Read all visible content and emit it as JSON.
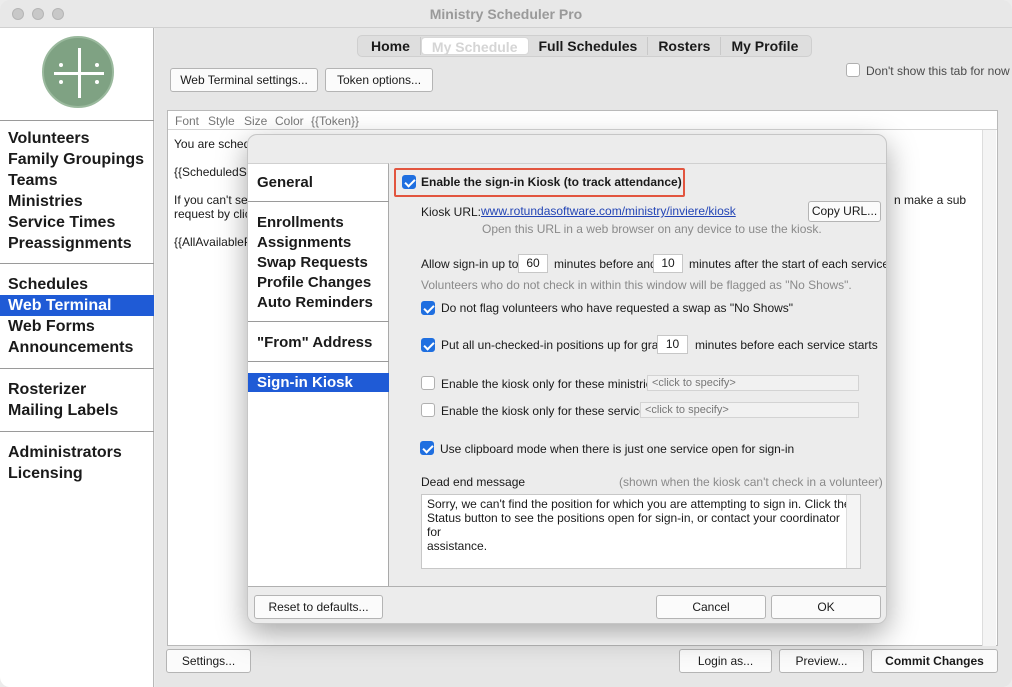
{
  "window": {
    "title": "Ministry Scheduler Pro"
  },
  "sidebar": {
    "groups": [
      [
        "Volunteers",
        "Family Groupings",
        "Teams",
        "Ministries",
        "Service Times",
        "Preassignments"
      ],
      [
        "Schedules",
        "Web Terminal",
        "Web Forms",
        "Announcements"
      ],
      [
        "Rosterizer",
        "Mailing Labels"
      ],
      [
        "Administrators",
        "Licensing"
      ]
    ],
    "active": "Web Terminal"
  },
  "top_tabs": [
    "Home",
    "My Schedule",
    "Full Schedules",
    "Rosters",
    "My Profile"
  ],
  "selected_tab": "My Schedule",
  "toolbar": {
    "web_terminal_settings": "Web Terminal settings...",
    "token_options": "Token options...",
    "dont_show_label": "Don't show this tab for now"
  },
  "editor": {
    "format_bar": [
      "Font",
      "Style",
      "Size",
      "Color",
      "{{Token}}"
    ],
    "line1": "You are sched",
    "line2": "{{ScheduledS",
    "line3a": "If you can't se",
    "line3b": "request by clic",
    "line3c": "n make a sub",
    "line4": "{{AllAvailableP"
  },
  "bottom_buttons": {
    "settings": "Settings...",
    "login_as": "Login as...",
    "preview": "Preview...",
    "commit": "Commit Changes"
  },
  "dialog": {
    "list": {
      "group1": [
        "General"
      ],
      "group2": [
        "Enrollments",
        "Assignments",
        "Swap Requests",
        "Profile Changes",
        "Auto Reminders"
      ],
      "group3": [
        "\"From\" Address"
      ],
      "group4": [
        "Sign-in Kiosk"
      ],
      "active": "Sign-in Kiosk"
    },
    "enable_kiosk": {
      "label": "Enable the sign-in Kiosk (to track attendance)",
      "checked": true
    },
    "kiosk_url": {
      "label": "Kiosk URL:",
      "url": "www.rotundasoftware.com/ministry/inviere/kiosk",
      "hint": "Open this URL in a web browser on any device to use the kiosk.",
      "copy_button": "Copy URL..."
    },
    "signin_window": {
      "prefix": "Allow sign-in up to",
      "before_value": "60",
      "middle": "minutes before and",
      "after_value": "10",
      "suffix": "minutes after the start of each service",
      "note": "Volunteers who do not check in within this window will be flagged as \"No Shows\"."
    },
    "no_flag_swap": {
      "label": "Do not flag volunteers who have requested a swap as \"No Shows\"",
      "checked": true
    },
    "grabs": {
      "label": "Put all un-checked-in positions up for grabs",
      "value": "10",
      "suffix": "minutes before each service starts",
      "checked": true
    },
    "only_ministries": {
      "label": "Enable the kiosk only for these ministries:",
      "placeholder": "<click to specify>",
      "checked": false
    },
    "only_services": {
      "label": "Enable the kiosk only for these services:",
      "placeholder": "<click to specify>",
      "checked": false
    },
    "clipboard_mode": {
      "label": "Use clipboard mode when there is just one service open for sign-in",
      "checked": true
    },
    "dead_end": {
      "label": "Dead end message",
      "hint": "(shown when the kiosk can't check in a volunteer)",
      "line1": "Sorry, we can't find the position for which you are attempting to sign in. Click the",
      "line2": "Status button to see the positions open for sign-in, or contact your coordinator for",
      "line3": "assistance."
    },
    "buttons": {
      "reset": "Reset to defaults...",
      "cancel": "Cancel",
      "ok": "OK"
    }
  }
}
